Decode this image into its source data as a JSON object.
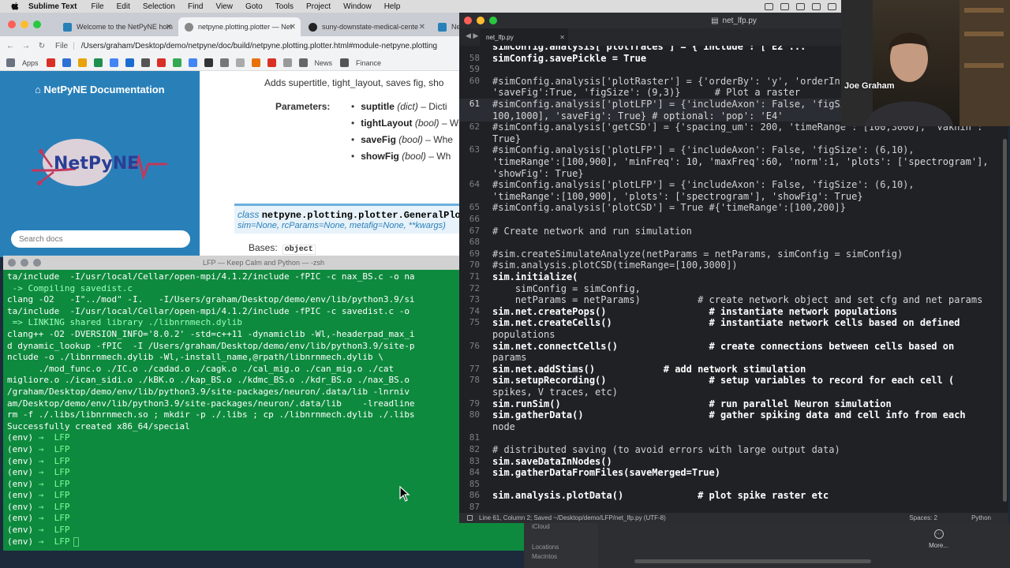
{
  "menubar": {
    "app": "Sublime Text",
    "items": [
      "File",
      "Edit",
      "Selection",
      "Find",
      "View",
      "Goto",
      "Tools",
      "Project",
      "Window",
      "Help"
    ]
  },
  "browser": {
    "tabs": [
      {
        "label": "Welcome to the NetPyNE hom",
        "active": false
      },
      {
        "label": "netpyne.plotting.plotter — Net",
        "active": true
      },
      {
        "label": "suny-downstate-medical-cente",
        "active": false
      },
      {
        "label": "Ne",
        "active": false
      }
    ],
    "file_label": "File",
    "url": "/Users/graham/Desktop/demo/netpyne/doc/build/netpyne.plotting.plotter.html#module-netpyne.plotting",
    "bookmarks": {
      "apps": "Apps",
      "news": "News",
      "finance": "Finance"
    }
  },
  "docs": {
    "sidebar_title": "NetPyNE Documentation",
    "logo_text": "NetPyNE",
    "search_placeholder": "Search docs",
    "intro": "Adds supertitle, tight_layout, saves fig, sho",
    "params_label": "Parameters:",
    "params": [
      {
        "name": "suptitle",
        "type": "(dict)",
        "rest": " – Dicti"
      },
      {
        "name": "tightLayout",
        "type": "(bool)",
        "rest": " – Whe"
      },
      {
        "name": "saveFig",
        "type": "(bool)",
        "rest": " – Whe"
      },
      {
        "name": "showFig",
        "type": "(bool)",
        "rest": " – Wh"
      }
    ],
    "sig_kw": "class",
    "sig_name": "netpyne.plotting.plotter.GeneralPlo",
    "sig_args": "sim=None, rcParams=None, metafig=None, **kwargs)",
    "bases_label": "Bases:",
    "bases_value": "object"
  },
  "terminal": {
    "title": "LFP — Keep Calm and Python — -zsh",
    "lines": [
      "ta/include  -I/usr/local/Cellar/open-mpi/4.1.2/include -fPIC -c nax_BS.c -o na",
      " -> Compiling savedist.c",
      "clang -O2   -I\"../mod\" -I.   -I/Users/graham/Desktop/demo/env/lib/python3.9/si",
      "ta/include  -I/usr/local/Cellar/open-mpi/4.1.2/include -fPIC -c savedist.c -o",
      " => LINKING shared library ./libnrnmech.dylib",
      "clang++ -O2 -DVERSION_INFO='8.0.2' -std=c++11 -dynamiclib -Wl,-headerpad_max_i",
      "d dynamic_lookup -fPIC  -I /Users/graham/Desktop/demo/env/lib/python3.9/site-p",
      "nclude -o ./libnrnmech.dylib -Wl,-install_name,@rpath/libnrnmech.dylib \\",
      "      ./mod_func.o ./IC.o ./cadad.o ./cagk.o ./cal_mig.o ./can_mig.o ./cat",
      "migliore.o ./ican_sidi.o ./kBK.o ./kap_BS.o ./kdmc_BS.o ./kdr_BS.o ./nax_BS.o",
      "/graham/Desktop/demo/env/lib/python3.9/site-packages/neuron/.data/lib -lnrniv",
      "am/Desktop/demo/env/lib/python3.9/site-packages/neuron/.data/lib    -lreadline",
      "rm -f ./.libs/libnrnmech.so ; mkdir -p ./.libs ; cp ./libnrnmech.dylib ./.libs",
      "Successfully created x86_64/special"
    ],
    "prompt_env": "(env)",
    "prompt_arrow": "→",
    "prompt_dir": "LFP",
    "prompt_count": 10
  },
  "sublime": {
    "title": "net_lfp.py",
    "tab": "net_lfp.py",
    "status_left": "Line 61, Column 2; Saved ~/Desktop/demo/LFP/net_lfp.py (UTF-8)",
    "spaces": "Spaces: 2",
    "syntax": "Python",
    "lines": [
      {
        "n": "",
        "t": "simConfig.analysis['plotTraces'] = {'include': ['E2'..."
      },
      {
        "n": "58",
        "t": "simConfig.savePickle = True"
      },
      {
        "n": "59",
        "t": ""
      },
      {
        "n": "60",
        "t": "#simConfig.analysis['plotRaster'] = {'orderBy': 'y', 'orderIn"
      },
      {
        "n": "",
        "t": "'saveFig':True, 'figSize': (9,3)}      # Plot a raster"
      },
      {
        "n": "61",
        "t": "#simConfig.analysis['plotLFP'] = {'includeAxon': False, 'figSize': (6,10), 'timeRange': ["
      },
      {
        "n": "",
        "t": "100,1000], 'saveFig': True} # optional: 'pop': 'E4'"
      },
      {
        "n": "62",
        "t": "#simConfig.analysis['getCSD'] = {'spacing_um': 200, 'timeRange': [100,3000], 'vaknin':"
      },
      {
        "n": "",
        "t": "True}"
      },
      {
        "n": "63",
        "t": "#simConfig.analysis['plotLFP'] = {'includeAxon': False, 'figSize': (6,10),"
      },
      {
        "n": "",
        "t": "'timeRange':[100,900], 'minFreq': 10, 'maxFreq':60, 'norm':1, 'plots': ['spectrogram'],"
      },
      {
        "n": "",
        "t": "'showFig': True}"
      },
      {
        "n": "64",
        "t": "#simConfig.analysis['plotLFP'] = {'includeAxon': False, 'figSize': (6,10),"
      },
      {
        "n": "",
        "t": "'timeRange':[100,900], 'plots': ['spectrogram'], 'showFig': True}"
      },
      {
        "n": "65",
        "t": "#simConfig.analysis['plotCSD'] = True #{'timeRange':[100,200]}"
      },
      {
        "n": "66",
        "t": ""
      },
      {
        "n": "67",
        "t": "# Create network and run simulation"
      },
      {
        "n": "68",
        "t": ""
      },
      {
        "n": "69",
        "t": "#sim.createSimulateAnalyze(netParams = netParams, simConfig = simConfig)"
      },
      {
        "n": "70",
        "t": "#sim.analysis.plotCSD(timeRange=[100,3000])"
      },
      {
        "n": "71",
        "t": "sim.initialize("
      },
      {
        "n": "72",
        "t": "    simConfig = simConfig,"
      },
      {
        "n": "73",
        "t": "    netParams = netParams)          # create network object and set cfg and net params"
      },
      {
        "n": "74",
        "t": "sim.net.createPops()                  # instantiate network populations"
      },
      {
        "n": "75",
        "t": "sim.net.createCells()                 # instantiate network cells based on defined"
      },
      {
        "n": "",
        "t": "populations"
      },
      {
        "n": "76",
        "t": "sim.net.connectCells()                # create connections between cells based on"
      },
      {
        "n": "",
        "t": "params"
      },
      {
        "n": "77",
        "t": "sim.net.addStims()            # add network stimulation"
      },
      {
        "n": "78",
        "t": "sim.setupRecording()                  # setup variables to record for each cell ("
      },
      {
        "n": "",
        "t": "spikes, V traces, etc)"
      },
      {
        "n": "79",
        "t": "sim.runSim()                          # run parallel Neuron simulation"
      },
      {
        "n": "80",
        "t": "sim.gatherData()                      # gather spiking data and cell info from each"
      },
      {
        "n": "",
        "t": "node"
      },
      {
        "n": "81",
        "t": ""
      },
      {
        "n": "82",
        "t": "# distributed saving (to avoid errors with large output data)"
      },
      {
        "n": "83",
        "t": "sim.saveDataInNodes()"
      },
      {
        "n": "84",
        "t": "sim.gatherDataFromFiles(saveMerged=True)"
      },
      {
        "n": "85",
        "t": ""
      },
      {
        "n": "86",
        "t": "sim.analysis.plotData()             # plot spike raster etc"
      },
      {
        "n": "87",
        "t": ""
      }
    ]
  },
  "finder": {
    "locations": "Locations",
    "item": "Macintos",
    "cloud": "iCloud",
    "more": "More..."
  },
  "webcam": {
    "name": "Joe Graham"
  }
}
